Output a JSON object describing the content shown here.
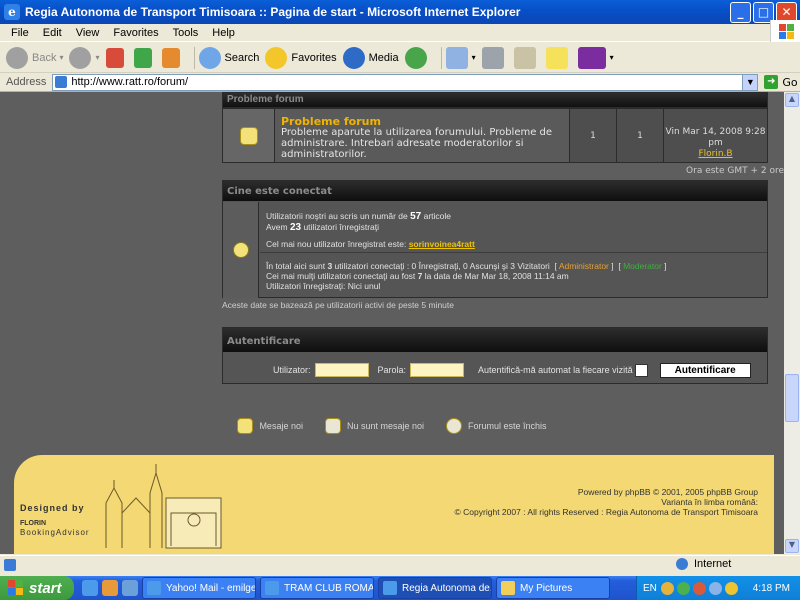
{
  "window": {
    "title": "Regia Autonoma de Transport Timisoara :: Pagina de start - Microsoft Internet Explorer"
  },
  "menu": [
    "File",
    "Edit",
    "View",
    "Favorites",
    "Tools",
    "Help"
  ],
  "toolbar": {
    "back": "Back",
    "search": "Search",
    "favorites": "Favorites",
    "media": "Media"
  },
  "address": {
    "label": "Address",
    "url": "http://www.ratt.ro/forum/",
    "go": "Go"
  },
  "forum": {
    "section_header": "Probleme forum",
    "name": "Probleme forum",
    "description": "Probleme aparute la utilizarea forumului. Probleme de administrare. Intrebari adresate moderatorilor si administratorilor.",
    "topics": "1",
    "posts": "1",
    "last_post_date": "Vin Mar 14, 2008 9:28 pm",
    "last_post_user": "Florin.B",
    "timezone": "Ora este GMT + 2 ore"
  },
  "who": {
    "header": "Cine este conectat",
    "line1_pre": "Utilizatorii noştri au scris un număr de",
    "articles": "57",
    "line1_post": "articole",
    "line2_pre": "Avem",
    "users": "23",
    "line2_post": "utilizatori înregistraţi",
    "newest_pre": "Cel mai nou utilizator înregistrat este:",
    "newest_user": "sorinvoinea4ratt",
    "online_pre": "În total aici sunt",
    "online_count": "3",
    "online_post": "utilizatori conectaţi : 0 Înregistraţi, 0 Ascunşi şi 3 Vizitatori",
    "admin_label": "Administrator",
    "mod_label": "Moderator",
    "max_pre": "Cei mai mulţi utilizatori conectaţi au fost",
    "max_count": "7",
    "max_post": "la data de Mar Mar 18, 2008 11:14 am",
    "registered_online": "Utilizatori înregistraţi: Nici unul",
    "note": "Aceste date se bazează pe utilizatorii activi de peste 5 minute"
  },
  "auth": {
    "header": "Autentificare",
    "username_label": "Utilizator:",
    "password_label": "Parola:",
    "remember_label": "Autentifică-mă automat la fiecare vizită",
    "submit": "Autentificare"
  },
  "legend": {
    "new": "Mesaje noi",
    "no_new": "Nu sunt mesaje noi",
    "locked": "Forumul este închis"
  },
  "footer": {
    "designed_by": "Designed by",
    "florin": "FLORIN",
    "booking": "BookingAdvisor",
    "powered": "Powered by phpBB © 2001, 2005 phpBB Group",
    "language": "Varianta în limba română:",
    "copyright": "© Copyright 2007 : All rights Reserved : Regia Autonoma de Transport Timisoara"
  },
  "status": {
    "zone": "Internet"
  },
  "taskbar": {
    "start": "start",
    "tasks": [
      "Yahoo! Mail - emilge...",
      "TRAM CLUB ROMAN...",
      "Regia Autonoma de...",
      "My Pictures"
    ],
    "lang": "EN",
    "clock": "4:18 PM"
  },
  "colors": {
    "title_blue": "#0850C8",
    "forum_accent": "#F0B400",
    "admin": "#E7A132",
    "moderator": "#3EAE3E",
    "footer_yellow": "#F3D873"
  }
}
